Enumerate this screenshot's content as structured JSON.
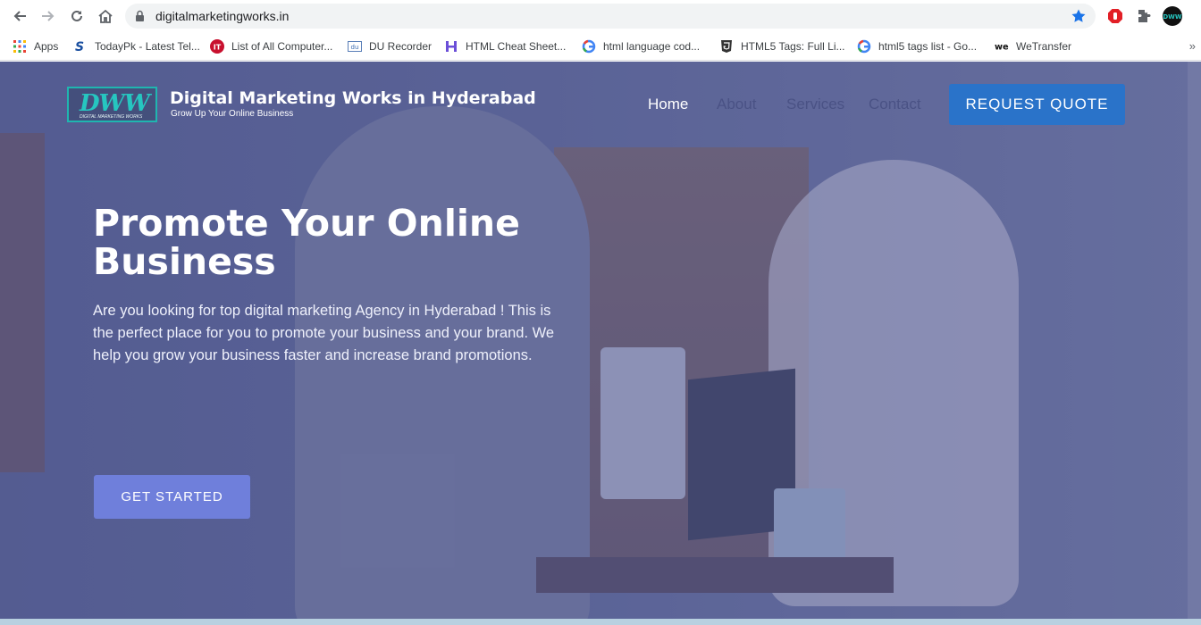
{
  "browser": {
    "url": "digitalmarketingworks.in",
    "bookmarks": [
      {
        "label": "Apps",
        "icon": "apps-grid-icon"
      },
      {
        "label": "TodayPk - Latest Tel...",
        "icon": "todaypk-icon"
      },
      {
        "label": "List of All Computer...",
        "icon": "it-icon"
      },
      {
        "label": "DU Recorder",
        "icon": "du-icon"
      },
      {
        "label": "HTML Cheat Sheet...",
        "icon": "h-icon"
      },
      {
        "label": "html language cod...",
        "icon": "google-icon"
      },
      {
        "label": "HTML5 Tags: Full Li...",
        "icon": "shield-icon"
      },
      {
        "label": "html5 tags list - Go...",
        "icon": "google-icon"
      },
      {
        "label": "WeTransfer",
        "icon": "wetransfer-icon"
      }
    ],
    "more": "»"
  },
  "site": {
    "logo_text": "DWW",
    "logo_sub": "DIGITAL MARKETING WORKS",
    "brand_title": "Digital Marketing Works in Hyderabad",
    "brand_tagline": "Grow Up Your Online Business",
    "nav": [
      {
        "label": "Home",
        "active": true
      },
      {
        "label": "About",
        "active": false
      },
      {
        "label": "Services",
        "active": false
      },
      {
        "label": "Contact",
        "active": false
      }
    ],
    "quote_button": "REQUEST QUOTE"
  },
  "hero": {
    "headline": "Promote Your Online Business",
    "lead": "Are you looking for top digital marketing Agency  in Hyderabad ! This is the perfect place for you to promote your business and your brand. We help you grow your business faster and increase brand promotions.",
    "cta": "GET STARTED"
  },
  "colors": {
    "accent": "#2a73c9",
    "cta": "#6f7fdb",
    "logo": "#26c6c0"
  }
}
